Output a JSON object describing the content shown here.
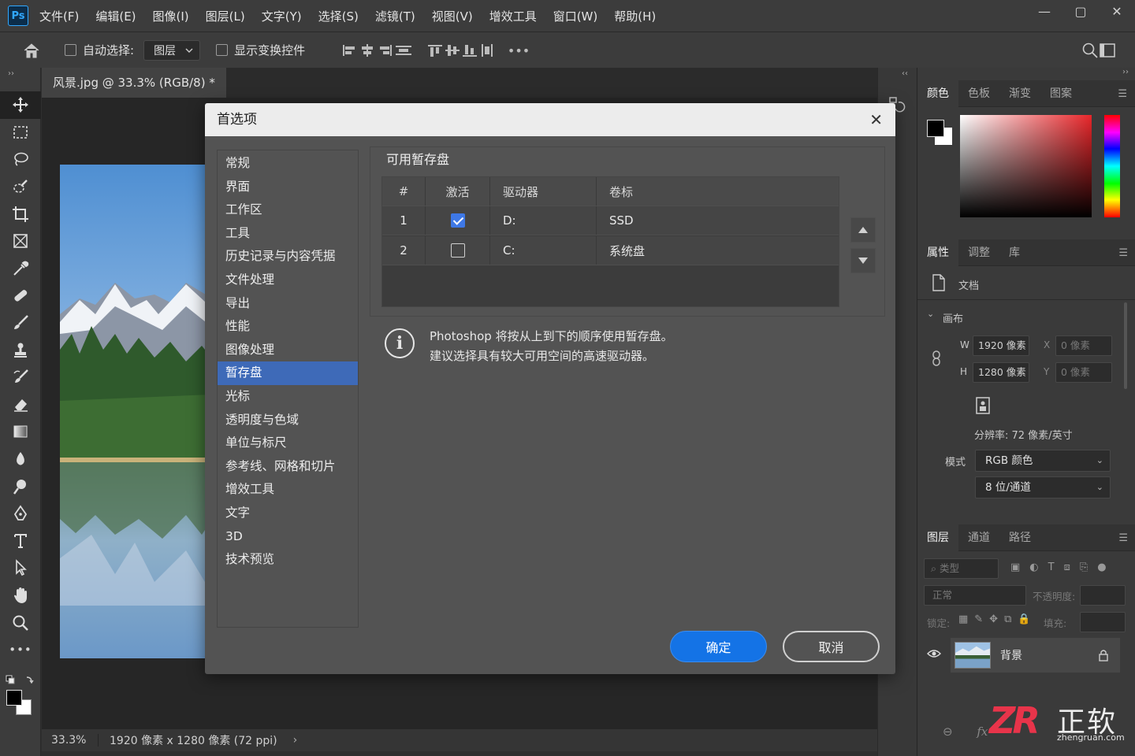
{
  "app": {
    "logo": "Ps",
    "menu": [
      "文件(F)",
      "编辑(E)",
      "图像(I)",
      "图层(L)",
      "文字(Y)",
      "选择(S)",
      "滤镜(T)",
      "视图(V)",
      "增效工具",
      "窗口(W)",
      "帮助(H)"
    ],
    "window_controls": [
      "—",
      "▢",
      "✕"
    ]
  },
  "options_bar": {
    "auto_select_label": "自动选择:",
    "auto_select_value": "图层",
    "show_transform_label": "显示变换控件",
    "more": "•••"
  },
  "document": {
    "tab_title": "风景.jpg @ 33.3% (RGB/8) *",
    "zoom": "33.3%",
    "dimensions": "1920 像素 x 1280 像素 (72 ppi)",
    "status_arrow": "›"
  },
  "dialog": {
    "title": "首选项",
    "close": "✕",
    "nav": [
      "常规",
      "界面",
      "工作区",
      "工具",
      "历史记录与内容凭据",
      "文件处理",
      "导出",
      "性能",
      "图像处理",
      "暂存盘",
      "光标",
      "透明度与色域",
      "单位与标尺",
      "参考线、网格和切片",
      "增效工具",
      "文字",
      "3D",
      "技术预览"
    ],
    "nav_selected": "暂存盘",
    "group_title": "可用暂存盘",
    "table": {
      "headers": [
        "#",
        "激活",
        "驱动器",
        "卷标"
      ],
      "rows": [
        {
          "num": "1",
          "active": true,
          "drive": "D:",
          "label": "SSD"
        },
        {
          "num": "2",
          "active": false,
          "drive": "C:",
          "label": "系统盘"
        }
      ]
    },
    "info_icon": "i",
    "info_line1": "Photoshop 将按从上到下的顺序使用暂存盘。",
    "info_line2": "建议选择具有较大可用空间的高速驱动器。",
    "ok": "确定",
    "cancel": "取消"
  },
  "panels": {
    "color_tabs": [
      "颜色",
      "色板",
      "渐变",
      "图案"
    ],
    "props_tabs": [
      "属性",
      "调整",
      "库"
    ],
    "doc_label": "文档",
    "canvas_label": "画布",
    "w_label": "W",
    "w_value": "1920 像素",
    "h_label": "H",
    "h_value": "1280 像素",
    "x_label": "X",
    "x_value": "0 像素",
    "y_label": "Y",
    "y_value": "0 像素",
    "resolution": "分辨率: 72 像素/英寸",
    "mode_label": "模式",
    "mode_value": "RGB 颜色",
    "depth_value": "8 位/通道",
    "layers_tabs": [
      "图层",
      "通道",
      "路径"
    ],
    "kind_filter": "类型",
    "blend_mode": "正常",
    "opacity_label": "不透明度:",
    "lock_label": "锁定:",
    "fill_label": "填充:",
    "layer_name": "背景"
  },
  "watermark": {
    "logo": "ZR",
    "text": "正软",
    "url": "zhengruan.com"
  },
  "colors": {
    "accent": "#1473e6",
    "selection": "#3e6ab8"
  }
}
